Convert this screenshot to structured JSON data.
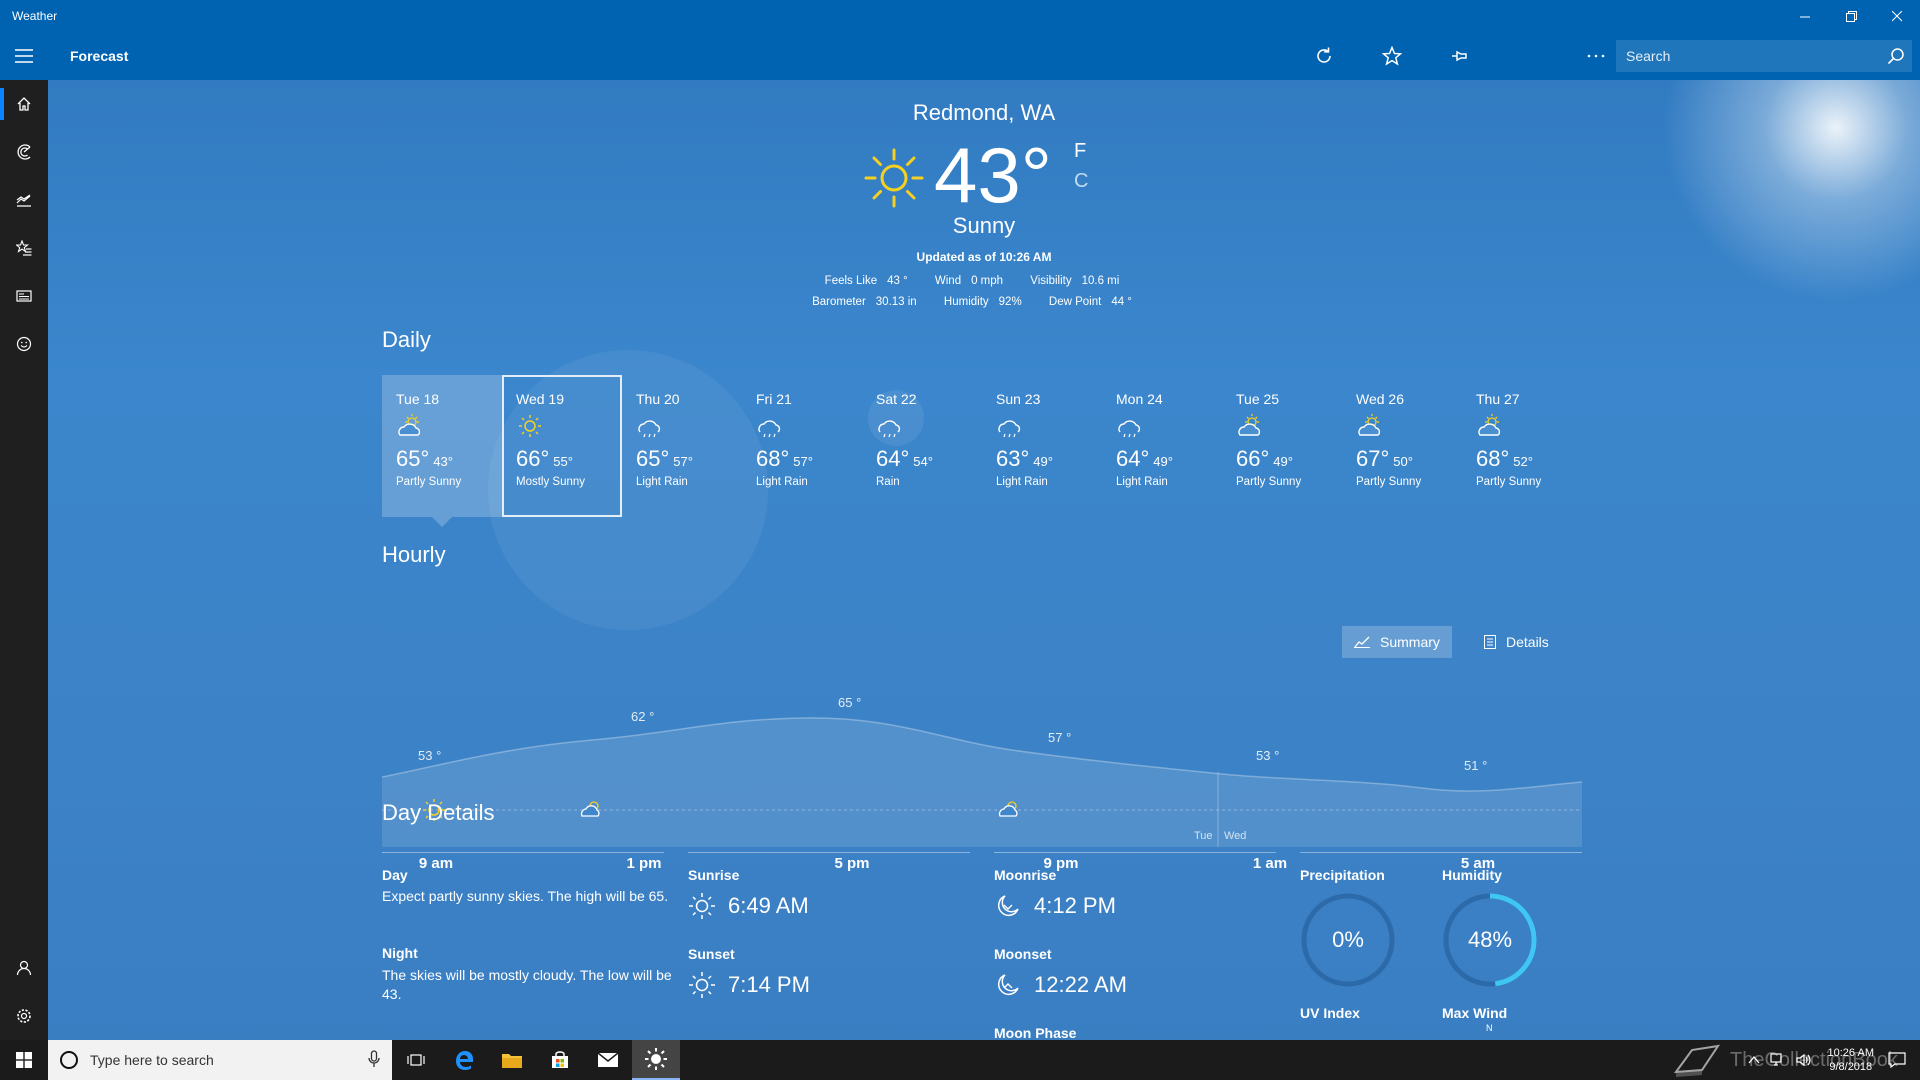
{
  "window": {
    "title": "Weather"
  },
  "commandbar": {
    "page": "Forecast",
    "search_placeholder": "Search"
  },
  "current": {
    "location": "Redmond, WA",
    "temp": "43",
    "degree": "°",
    "unit_f": "F",
    "unit_c": "C",
    "condition": "Sunny",
    "updated": "Updated as of 10:26 AM",
    "stats_row1": [
      {
        "k": "Feels Like",
        "v": "43 °"
      },
      {
        "k": "Wind",
        "v": "0 mph"
      },
      {
        "k": "Visibility",
        "v": "10.6 mi"
      }
    ],
    "stats_row2": [
      {
        "k": "Barometer",
        "v": "30.13 in"
      },
      {
        "k": "Humidity",
        "v": "92%"
      },
      {
        "k": "Dew Point",
        "v": "44 °"
      }
    ]
  },
  "daily": {
    "title": "Daily",
    "days": [
      {
        "name": "Tue 18",
        "high": "65°",
        "low": "43°",
        "cond": "Partly Sunny",
        "icon": "partly-sunny"
      },
      {
        "name": "Wed 19",
        "high": "66°",
        "low": "55°",
        "cond": "Mostly Sunny",
        "icon": "sunny"
      },
      {
        "name": "Thu 20",
        "high": "65°",
        "low": "57°",
        "cond": "Light Rain",
        "icon": "rain"
      },
      {
        "name": "Fri 21",
        "high": "68°",
        "low": "57°",
        "cond": "Light Rain",
        "icon": "rain"
      },
      {
        "name": "Sat 22",
        "high": "64°",
        "low": "54°",
        "cond": "Rain",
        "icon": "rain"
      },
      {
        "name": "Sun 23",
        "high": "63°",
        "low": "49°",
        "cond": "Light Rain",
        "icon": "rain"
      },
      {
        "name": "Mon 24",
        "high": "64°",
        "low": "49°",
        "cond": "Light Rain",
        "icon": "rain"
      },
      {
        "name": "Tue 25",
        "high": "66°",
        "low": "49°",
        "cond": "Partly Sunny",
        "icon": "partly-sunny"
      },
      {
        "name": "Wed 26",
        "high": "67°",
        "low": "50°",
        "cond": "Partly Sunny",
        "icon": "partly-sunny"
      },
      {
        "name": "Thu 27",
        "high": "68°",
        "low": "52°",
        "cond": "Partly Sunny",
        "icon": "partly-sunny"
      }
    ]
  },
  "hourly": {
    "title": "Hourly",
    "tab_summary": "Summary",
    "tab_details": "Details",
    "temps": [
      "53 °",
      "62 °",
      "65 °",
      "57 °",
      "53 °",
      "51 °"
    ],
    "hours": [
      "9 am",
      "1 pm",
      "5 pm",
      "9 pm",
      "1 am",
      "5 am"
    ],
    "day_tue": "Tue",
    "day_wed": "Wed"
  },
  "day_details": {
    "title": "Day Details",
    "day_label": "Day",
    "day_text": "Expect partly sunny skies. The high will be 65.",
    "night_label": "Night",
    "night_text": "The skies will be mostly cloudy. The low will be 43.",
    "sunrise_label": "Sunrise",
    "sunrise": "6:49 AM",
    "sunset_label": "Sunset",
    "sunset": "7:14 PM",
    "moonrise_label": "Moonrise",
    "moonrise": "4:12 PM",
    "moonset_label": "Moonset",
    "moonset": "12:22 AM",
    "moonphase_label": "Moon Phase",
    "precip_label": "Precipitation",
    "precip": "0%",
    "precip_value": 0,
    "humidity_label": "Humidity",
    "humidity": "48%",
    "humidity_value": 48,
    "uv_label": "UV Index",
    "maxwind_label": "Max Wind",
    "maxwind_dir": "N"
  },
  "taskbar": {
    "search_placeholder": "Type here to search",
    "time": "10:26 AM",
    "date": "9/8/2018",
    "watermark": "TheCollectionBook"
  },
  "colors": {
    "titlebar": "#0063b1",
    "nav": "#1f1f1f",
    "sun": "#f5d020",
    "ring": "#3fc6f2",
    "taskbar": "#1b1b1b"
  }
}
